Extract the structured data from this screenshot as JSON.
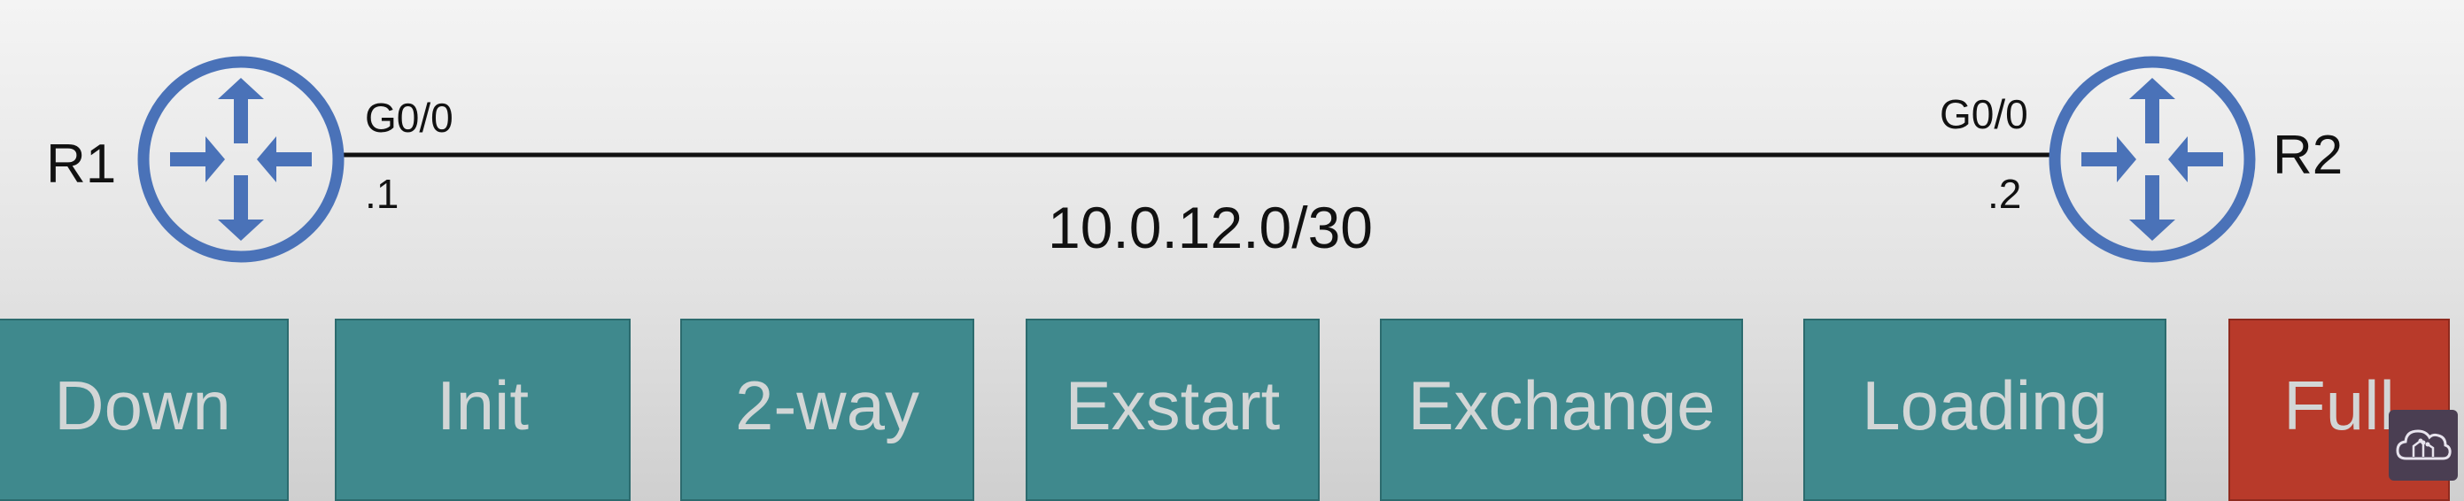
{
  "routers": [
    {
      "name": "R1",
      "interface": "G0/0",
      "ip": ".1"
    },
    {
      "name": "R2",
      "interface": "G0/0",
      "ip": ".2"
    }
  ],
  "link": {
    "subnet": "10.0.12.0/30"
  },
  "states": [
    "Down",
    "Init",
    "2-way",
    "Exstart",
    "Exchange",
    "Loading",
    "Full"
  ],
  "colors": {
    "router": "#4a72b8",
    "state_box": "#3f898d",
    "state_full": "#b83a2a",
    "state_text": "#d2d6d6"
  },
  "icons": {
    "router": "router-icon",
    "watermark": "cloud-circuit-icon"
  }
}
